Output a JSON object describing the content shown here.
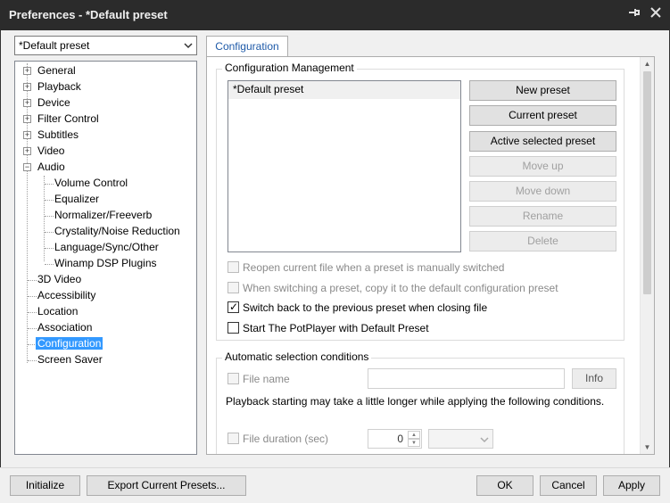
{
  "window": {
    "title": "Preferences - *Default preset",
    "pin_icon": "pin-icon",
    "close_icon": "close-icon"
  },
  "preset_select": {
    "value": "*Default preset"
  },
  "tree": {
    "items": [
      {
        "label": "General",
        "expander": "+"
      },
      {
        "label": "Playback",
        "expander": "+"
      },
      {
        "label": "Device",
        "expander": "+"
      },
      {
        "label": "Filter Control",
        "expander": "+"
      },
      {
        "label": "Subtitles",
        "expander": "+"
      },
      {
        "label": "Video",
        "expander": "+"
      },
      {
        "label": "Audio",
        "expander": "−"
      },
      {
        "label": "Volume Control"
      },
      {
        "label": "Equalizer"
      },
      {
        "label": "Normalizer/Freeverb"
      },
      {
        "label": "Crystality/Noise Reduction"
      },
      {
        "label": "Language/Sync/Other"
      },
      {
        "label": "Winamp DSP Plugins"
      },
      {
        "label": "3D Video"
      },
      {
        "label": "Accessibility"
      },
      {
        "label": "Location"
      },
      {
        "label": "Association"
      },
      {
        "label": "Configuration"
      },
      {
        "label": "Screen Saver"
      }
    ]
  },
  "tab": {
    "label": "Configuration"
  },
  "config_management": {
    "legend": "Configuration Management",
    "list_items": [
      "*Default preset"
    ],
    "buttons": {
      "new_preset": "New preset",
      "current_preset": "Current preset",
      "active_selected_preset": "Active selected preset",
      "move_up": "Move up",
      "move_down": "Move down",
      "rename": "Rename",
      "delete": "Delete"
    },
    "options": {
      "reopen": "Reopen current file when a preset is manually switched",
      "copy_default": "When switching a preset, copy it to the default configuration preset",
      "switch_back": "Switch back to the previous preset when closing file",
      "start_default": "Start The PotPlayer with Default Preset"
    }
  },
  "auto_selection": {
    "legend": "Automatic selection conditions",
    "file_name_label": "File name",
    "info_button": "Info",
    "note": "Playback starting may take a little longer while applying the following conditions.",
    "file_duration_label": "File duration (sec)",
    "duration_value": "0"
  },
  "footer": {
    "initialize": "Initialize",
    "export": "Export Current Presets...",
    "ok": "OK",
    "cancel": "Cancel",
    "apply": "Apply"
  }
}
